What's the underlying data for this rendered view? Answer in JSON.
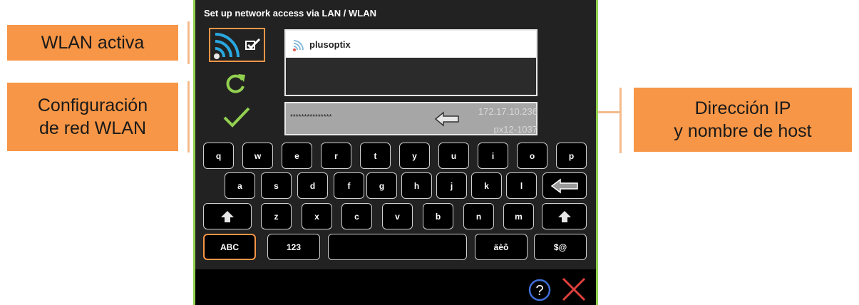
{
  "callouts": {
    "wlan_activa": "WLAN activa",
    "config_line1": "Configuración",
    "config_line2": "de red WLAN",
    "ip_line1": "Dirección IP",
    "ip_line2": "y nombre de host"
  },
  "screen": {
    "title": "Set up network access via LAN / WLAN",
    "network_name": "plusoptix",
    "password_mask": "***************",
    "ip_address": "172.17.10.236",
    "hostname": "px12-1037"
  },
  "keyboard": {
    "row1": [
      "q",
      "w",
      "e",
      "r",
      "t",
      "y",
      "u",
      "i",
      "o",
      "p"
    ],
    "row2": [
      "a",
      "s",
      "d",
      "f",
      "g",
      "h",
      "j",
      "k",
      "l"
    ],
    "row3": [
      "z",
      "x",
      "c",
      "v",
      "b",
      "n",
      "m"
    ],
    "abc": "ABC",
    "num": "123",
    "space": "",
    "umlaut": "äèô",
    "symbols": "$@"
  },
  "colors": {
    "accent_orange": "#f79646",
    "accent_green": "#92d050",
    "close_red": "#e0403c",
    "help_blue": "#3f6fd8"
  }
}
